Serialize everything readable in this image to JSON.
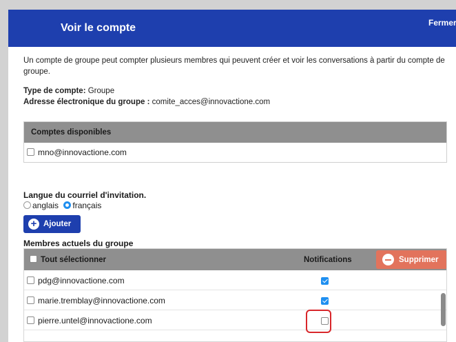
{
  "header": {
    "title": "Voir le compte",
    "close_label": "Fermer"
  },
  "description": "Un compte de groupe peut compter plusieurs membres qui peuvent créer et voir les conversations à partir du compte de groupe.",
  "account": {
    "type_label": "Type de compte:",
    "type_value": "Groupe",
    "email_label": "Adresse électronique du groupe :",
    "email_value": "comite_acces@innovactione.com"
  },
  "available": {
    "header": "Comptes disponibles",
    "items": [
      {
        "email": "mno@innovactione.com",
        "checked": false
      }
    ]
  },
  "language": {
    "title": "Langue du courriel d'invitation.",
    "options": [
      {
        "label": "anglais",
        "selected": false
      },
      {
        "label": "français",
        "selected": true
      }
    ]
  },
  "add_button": {
    "label": "Ajouter"
  },
  "members": {
    "title": "Membres actuels du groupe",
    "select_all_label": "Tout sélectionner",
    "notifications_header": "Notifications",
    "delete_label": "Supprimer",
    "rows": [
      {
        "email": "pdg@innovactione.com",
        "notifications": true
      },
      {
        "email": "marie.tremblay@innovactione.com",
        "notifications": true
      },
      {
        "email": "pierre.untel@innovactione.com",
        "notifications": false
      }
    ]
  },
  "colors": {
    "header_blue": "#1e3fae",
    "table_header_gray": "#8f8f8f",
    "delete_orange": "#e2735c",
    "checkbox_blue": "#1f8ff0",
    "highlight_red": "#d8262a"
  }
}
